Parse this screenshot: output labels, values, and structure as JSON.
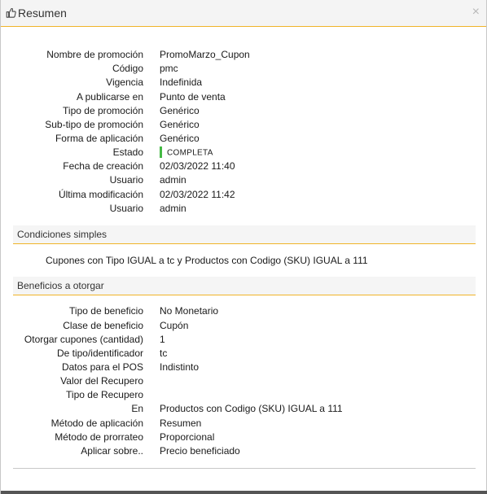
{
  "dialog": {
    "title": "Resumen",
    "close_icon": "×"
  },
  "summary": {
    "fields": [
      {
        "label": "Nombre de promoción",
        "value": "PromoMarzo_Cupon"
      },
      {
        "label": "Código",
        "value": "pmc"
      },
      {
        "label": "Vigencia",
        "value": "Indefinida"
      },
      {
        "label": "A publicarse en",
        "value": "Punto de venta"
      },
      {
        "label": "Tipo de promoción",
        "value": "Genérico"
      },
      {
        "label": "Sub-tipo de promoción",
        "value": "Genérico"
      },
      {
        "label": "Forma de aplicación",
        "value": "Genérico"
      },
      {
        "label": "Estado",
        "value": "COMPLETA"
      },
      {
        "label": "Fecha de creación",
        "value": "02/03/2022 11:40"
      },
      {
        "label": "Usuario",
        "value": "admin"
      },
      {
        "label": "Última modificación",
        "value": "02/03/2022 11:42"
      },
      {
        "label": "Usuario",
        "value": "admin"
      }
    ],
    "status_color": "#44b944"
  },
  "conditions": {
    "title": "Condiciones simples",
    "text": "Cupones con Tipo IGUAL a tc y Productos con Codigo (SKU) IGUAL a 111"
  },
  "benefits": {
    "title": "Beneficios a otorgar",
    "fields": [
      {
        "label": "Tipo de beneficio",
        "value": "No Monetario"
      },
      {
        "label": "Clase de beneficio",
        "value": "Cupón"
      },
      {
        "label": "Otorgar cupones (cantidad)",
        "value": "1"
      },
      {
        "label": "De tipo/identificador",
        "value": "tc"
      },
      {
        "label": "Datos para el POS",
        "value": "Indistinto"
      },
      {
        "label": "Valor del Recupero",
        "value": ""
      },
      {
        "label": "Tipo de Recupero",
        "value": ""
      },
      {
        "label": "En",
        "value": "Productos con Codigo (SKU) IGUAL a 111"
      },
      {
        "label": "Método de aplicación",
        "value": "Resumen"
      },
      {
        "label": "Método de prorrateo",
        "value": "Proporcional"
      },
      {
        "label": "Aplicar sobre..",
        "value": "Precio beneficiado"
      }
    ]
  },
  "colors": {
    "accent": "#f0b429"
  }
}
